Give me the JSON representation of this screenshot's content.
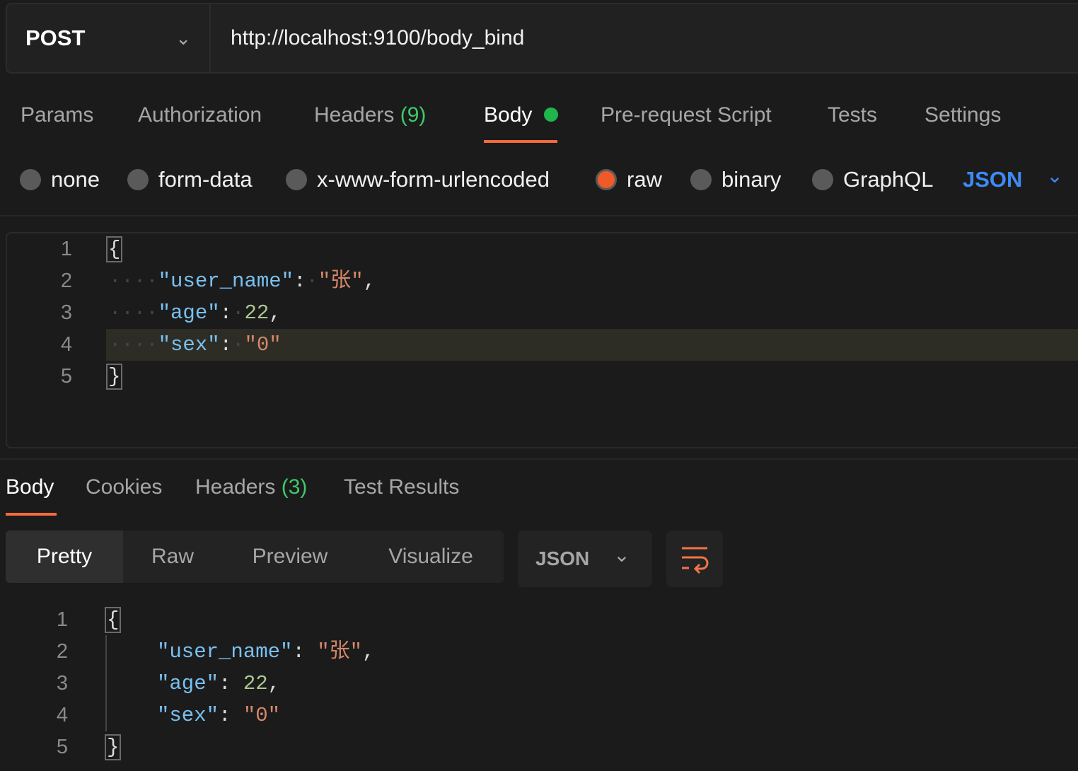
{
  "request": {
    "method": "POST",
    "url": "http://localhost:9100/body_bind"
  },
  "request_tabs": [
    {
      "label": "Params"
    },
    {
      "label": "Authorization"
    },
    {
      "label": "Headers",
      "count": "(9)"
    },
    {
      "label": "Body",
      "active": true
    },
    {
      "label": "Pre-request Script"
    },
    {
      "label": "Tests"
    },
    {
      "label": "Settings"
    }
  ],
  "body_types": [
    {
      "label": "none"
    },
    {
      "label": "form-data"
    },
    {
      "label": "x-www-form-urlencoded"
    },
    {
      "label": "raw",
      "selected": true
    },
    {
      "label": "binary"
    },
    {
      "label": "GraphQL"
    }
  ],
  "body_format": "JSON",
  "request_body": {
    "lines": [
      "1",
      "2",
      "3",
      "4",
      "5"
    ],
    "brace_open": "{",
    "brace_close": "}",
    "k1": "\"user_name\"",
    "v1": "\"张\"",
    "k2": "\"age\"",
    "v2": "22",
    "k3": "\"sex\"",
    "v3": "\"0\""
  },
  "response_tabs": [
    {
      "label": "Body",
      "active": true
    },
    {
      "label": "Cookies"
    },
    {
      "label": "Headers",
      "count": "(3)"
    },
    {
      "label": "Test Results"
    }
  ],
  "view_modes": [
    {
      "label": "Pretty",
      "active": true
    },
    {
      "label": "Raw"
    },
    {
      "label": "Preview"
    },
    {
      "label": "Visualize"
    }
  ],
  "response_format": "JSON",
  "colors": {
    "accent": "#f26b3a",
    "green": "#3ec96a",
    "link": "#3d8af7"
  }
}
